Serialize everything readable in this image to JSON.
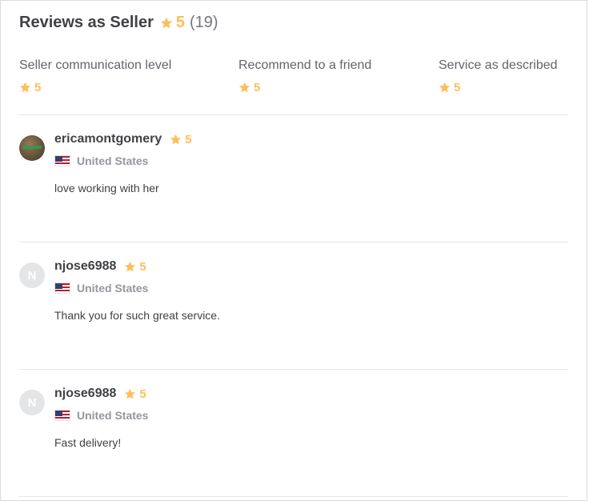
{
  "header": {
    "title": "Reviews as Seller",
    "rating": "5",
    "count": "(19)"
  },
  "breakdown": [
    {
      "label": "Seller communication level",
      "value": "5"
    },
    {
      "label": "Recommend to a friend",
      "value": "5"
    },
    {
      "label": "Service as described",
      "value": "5"
    }
  ],
  "reviews": [
    {
      "username": "ericamontgomery",
      "rating": "5",
      "country": "United States",
      "text": "love working with her",
      "avatar_letter": ""
    },
    {
      "username": "njose6988",
      "rating": "5",
      "country": "United States",
      "text": "Thank you for such great service.",
      "avatar_letter": "N"
    },
    {
      "username": "njose6988",
      "rating": "5",
      "country": "United States",
      "text": "Fast delivery!",
      "avatar_letter": "N"
    }
  ],
  "colors": {
    "star": "#ffbe5b",
    "text": "#404145",
    "muted": "#95979d",
    "divider": "#e4e5e7"
  },
  "icons": {
    "star": "star-icon",
    "flag": "us-flag-icon"
  }
}
